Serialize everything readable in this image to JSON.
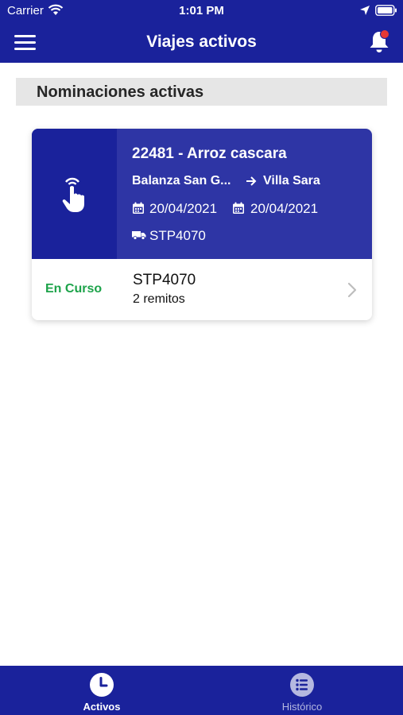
{
  "status_bar": {
    "carrier": "Carrier",
    "time": "1:01 PM",
    "icons": [
      "wifi-icon",
      "location-arrow-icon",
      "battery-icon"
    ]
  },
  "header": {
    "title": "Viajes activos",
    "menu_icon": "hamburger-menu-icon",
    "bell_icon": "bell-icon",
    "has_unread_notifications": true
  },
  "section": {
    "title": "Nominaciones activas"
  },
  "trip": {
    "title": "22481 - Arroz cascara",
    "origin": "Balanza San G...",
    "destination": "Villa Sara",
    "start_date": "20/04/2021",
    "end_date": "20/04/2021",
    "plate": "STP4070",
    "status": "En Curso",
    "vehicle": "STP4070",
    "remitos": "2 remitos"
  },
  "tabs": [
    {
      "label": "Activos",
      "icon": "clock-icon",
      "active": true
    },
    {
      "label": "Histórico",
      "icon": "list-icon",
      "active": false
    }
  ],
  "colors": {
    "primary": "#1A229B",
    "card_blue": "#2E35A5",
    "status_green": "#1DA34A",
    "badge_red": "#E53935",
    "tab_inactive": "#B5B8E0"
  }
}
